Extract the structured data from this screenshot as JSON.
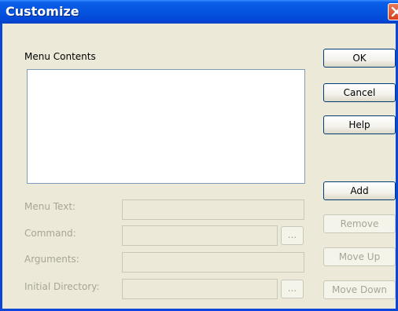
{
  "window": {
    "title": "Customize"
  },
  "menu_contents_label": "Menu Contents",
  "fields": {
    "menu_text_label": "Menu Text:",
    "command_label": "Command:",
    "arguments_label": "Arguments:",
    "initial_directory_label": "Initial Directory:",
    "browse_label": "..."
  },
  "buttons": {
    "ok": "OK",
    "cancel": "Cancel",
    "help": "Help",
    "add": "Add",
    "remove": "Remove",
    "move_up": "Move Up",
    "move_down": "Move Down"
  }
}
